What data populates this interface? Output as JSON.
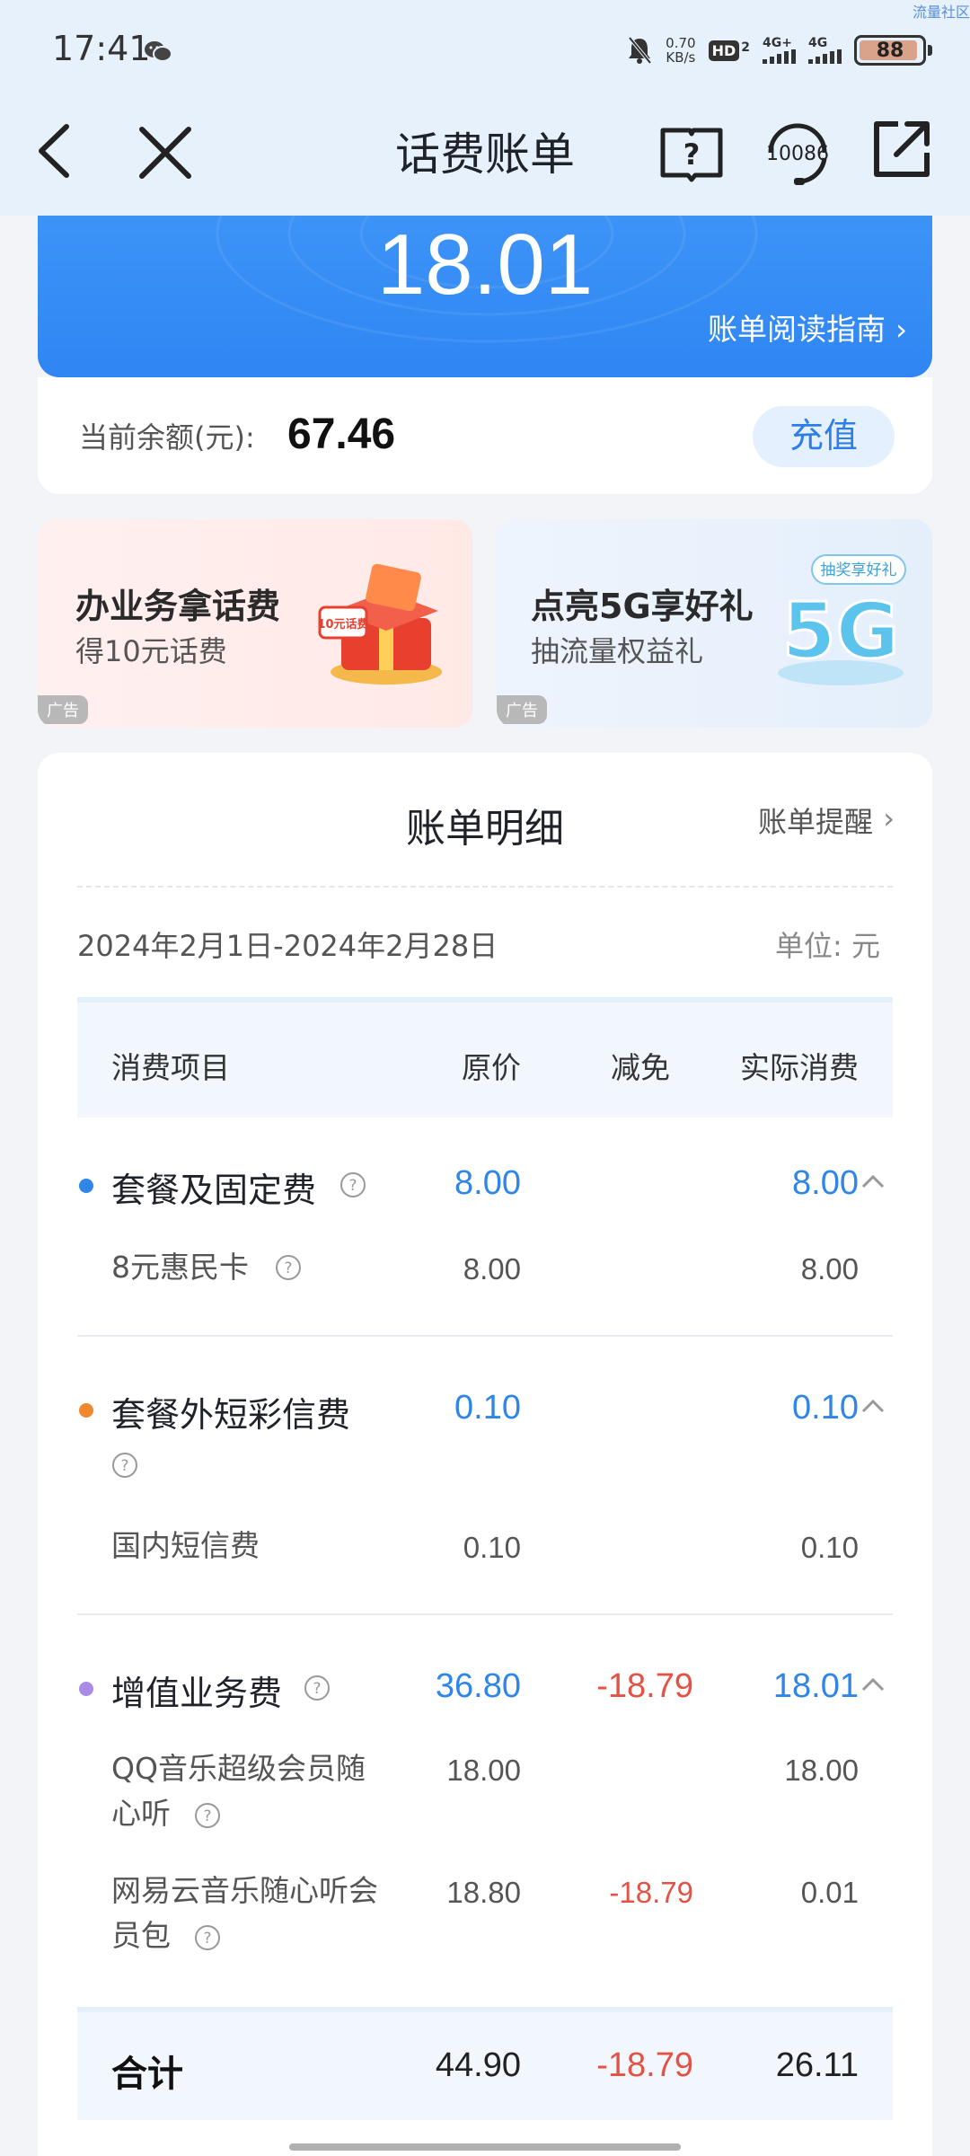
{
  "watermark": "流量社区",
  "status_bar": {
    "time": "17:41",
    "net_speed_value": "0.70",
    "net_speed_unit": "KB/s",
    "hd_label": "HD",
    "hd_sub": "2",
    "signal1_label": "4G+",
    "signal2_label": "4G",
    "battery": "88"
  },
  "nav": {
    "title": "话费账单",
    "service_number": "10086"
  },
  "hero": {
    "amount": "18.01",
    "guide_link": "账单阅读指南"
  },
  "balance": {
    "label": "当前余额(元):",
    "value": "67.46",
    "recharge_label": "充值"
  },
  "ads": [
    {
      "title": "办业务拿话费",
      "subtitle": "得10元话费",
      "tag": "广告",
      "badge": "10元话费"
    },
    {
      "title": "点亮5G享好礼",
      "subtitle": "抽流量权益礼",
      "tag": "广告",
      "badge": "抽奖享好礼",
      "mark": "5G"
    }
  ],
  "detail": {
    "title": "账单明细",
    "remind_link": "账单提醒",
    "period": "2024年2月1日-2024年2月28日",
    "unit": "单位: 元",
    "columns": [
      "消费项目",
      "原价",
      "减免",
      "实际消费"
    ],
    "groups": [
      {
        "name": "套餐及固定费",
        "color": "#2f86e8",
        "original": "8.00",
        "discount": "",
        "actual": "8.00",
        "items": [
          {
            "name": "8元惠民卡",
            "original": "8.00",
            "discount": "",
            "actual": "8.00"
          }
        ]
      },
      {
        "name": "套餐外短彩信费",
        "color": "#f0892e",
        "original": "0.10",
        "discount": "",
        "actual": "0.10",
        "items": [
          {
            "name": "国内短信费",
            "original": "0.10",
            "discount": "",
            "actual": "0.10"
          }
        ]
      },
      {
        "name": "增值业务费",
        "color": "#a98be8",
        "original": "36.80",
        "discount": "-18.79",
        "actual": "18.01",
        "items": [
          {
            "name_line1": "QQ音乐超级会员随",
            "name_line2": "心听",
            "original": "18.00",
            "discount": "",
            "actual": "18.00"
          },
          {
            "name_line1": "网易云音乐随心听会",
            "name_line2": "员包",
            "original": "18.80",
            "discount": "-18.79",
            "actual": "0.01"
          }
        ]
      }
    ],
    "total": {
      "label": "合计",
      "original": "44.90",
      "discount": "-18.79",
      "actual": "26.11"
    }
  }
}
